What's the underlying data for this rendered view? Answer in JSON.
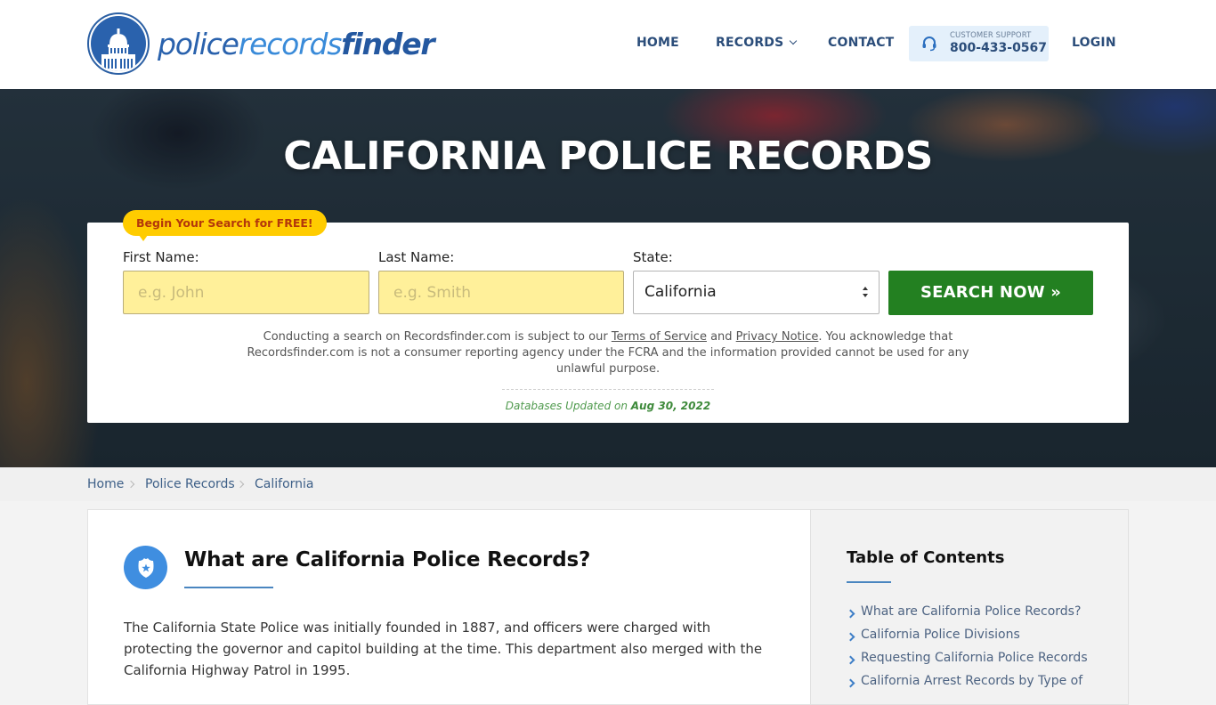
{
  "header": {
    "logo": {
      "part1": "police",
      "part2": "records",
      "part3": "finder"
    },
    "nav": {
      "home": "HOME",
      "records": "RECORDS",
      "contact": "CONTACT",
      "login": "LOGIN"
    },
    "support": {
      "label": "CUSTOMER SUPPORT",
      "phone": "800-433-0567",
      "icon": "headset-icon"
    }
  },
  "hero": {
    "title": "CALIFORNIA POLICE RECORDS",
    "badge": "Begin Your Search for FREE!",
    "form": {
      "first_name_label": "First Name:",
      "first_name_placeholder": "e.g. John",
      "first_name_value": "",
      "last_name_label": "Last Name:",
      "last_name_placeholder": "e.g. Smith",
      "last_name_value": "",
      "state_label": "State:",
      "state_selected": "California",
      "search_button": "SEARCH NOW »"
    },
    "disclaimer": {
      "part1": "Conducting a search on Recordsfinder.com is subject to our ",
      "terms_link": "Terms of Service",
      "part2": " and ",
      "privacy_link": "Privacy Notice",
      "part3": ". You acknowledge that Recordsfinder.com is not a consumer reporting agency under the FCRA and the information provided cannot be used for any unlawful purpose."
    },
    "db_updated": {
      "label": "Databases Updated on ",
      "date": "Aug 30, 2022"
    }
  },
  "breadcrumb": {
    "items": [
      "Home",
      "Police Records",
      "California"
    ]
  },
  "main": {
    "section_title": "What are California Police Records?",
    "section_icon": "police-badge-icon",
    "body": "The California State Police was initially founded in 1887, and officers were charged with protecting the governor and capitol building at the time. This department also merged with the California Highway Patrol in 1995."
  },
  "sidebar": {
    "toc_title": "Table of Contents",
    "items": [
      "What are California Police Records?",
      "California Police Divisions",
      "Requesting California Police Records",
      "California Arrest Records by Type of"
    ]
  },
  "colors": {
    "brand_blue": "#2a62ad",
    "nav_text": "#2b4d7a",
    "search_green": "#238021",
    "badge_yellow": "#ffcc00",
    "input_yellow": "#fff09a"
  }
}
